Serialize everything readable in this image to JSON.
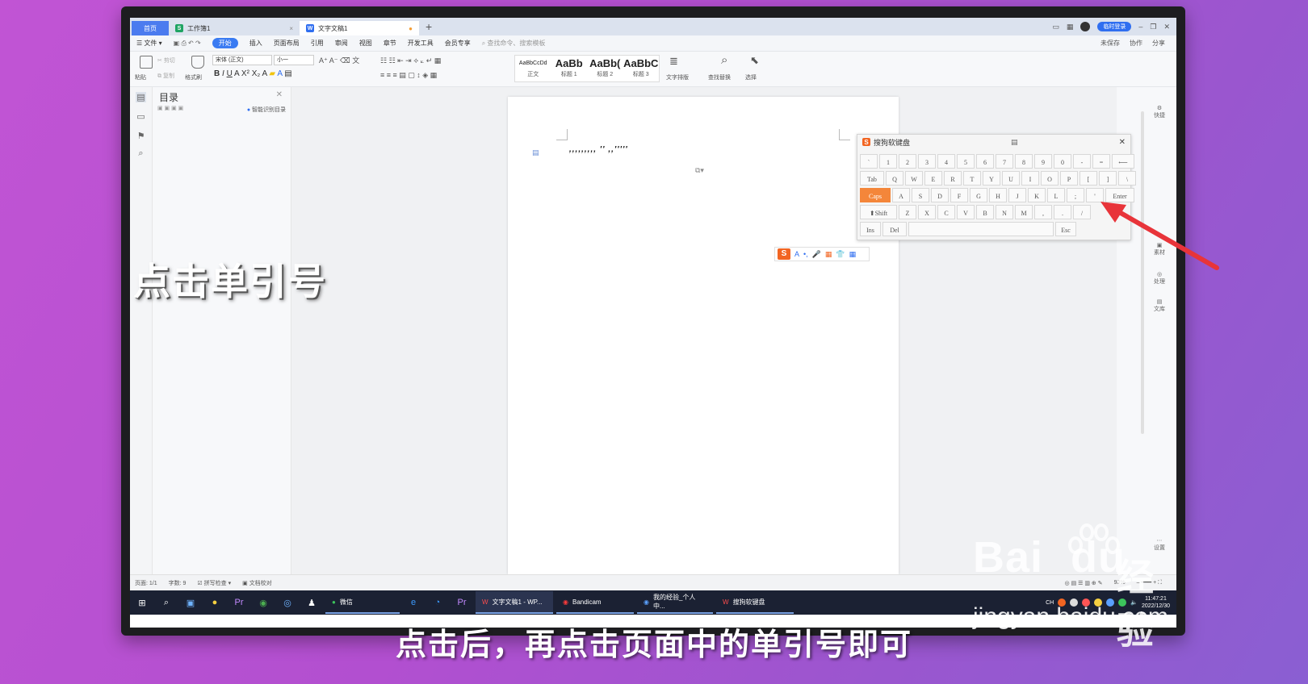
{
  "tabs": {
    "home": "首页",
    "sheet": "工作簿1",
    "doc": "文字文稿1",
    "login": "临时登录"
  },
  "menu": {
    "file": "文件",
    "items": [
      "开始",
      "插入",
      "页面布局",
      "引用",
      "审阅",
      "视图",
      "章节",
      "开发工具",
      "会员专享"
    ],
    "search": "查找命令、搜索模板",
    "right": [
      "未保存",
      "协作",
      "分享"
    ]
  },
  "ribbon": {
    "paste": "粘贴",
    "cut": "剪切",
    "copy": "复制",
    "format_painter": "格式刷",
    "font": "宋体 (正文)",
    "size": "小一",
    "styles": [
      {
        "sample": "AaBbCcDd",
        "name": "正文"
      },
      {
        "sample": "AaBb",
        "name": "标题 1"
      },
      {
        "sample": "AaBb(",
        "name": "标题 2"
      },
      {
        "sample": "AaBbC",
        "name": "标题 3"
      }
    ],
    "text_layout": "文字排版",
    "find_replace": "查找替换",
    "select": "选择"
  },
  "toc": {
    "title": "目录",
    "smart": "智能识别目录"
  },
  "document": {
    "text": ",,,,,,,,, '' ,,'''''"
  },
  "right_panel": [
    "快捷",
    "素材",
    "处理",
    "文库",
    "设置"
  ],
  "status": {
    "page": "页面: 1/1",
    "words": "字数: 9",
    "spell": "拼写检查",
    "proof": "文档校对",
    "zoom": "93%"
  },
  "taskbar": {
    "apps": [
      "微信",
      "文字文稿1 - WP...",
      "Bandicam",
      "我的经验_个人中...",
      "搜狗软键盘"
    ],
    "time": "11:47:21",
    "date": "2022/12/30",
    "lang": "CH"
  },
  "keyboard": {
    "title": "搜狗软键盘",
    "row1": [
      "`",
      "1",
      "2",
      "3",
      "4",
      "5",
      "6",
      "7",
      "8",
      "9",
      "0",
      "-",
      "=",
      "⟵"
    ],
    "row2": [
      "Tab",
      "Q",
      "W",
      "E",
      "R",
      "T",
      "Y",
      "U",
      "I",
      "O",
      "P",
      "[",
      "]",
      "\\"
    ],
    "row3": [
      "Caps",
      "A",
      "S",
      "D",
      "F",
      "G",
      "H",
      "J",
      "K",
      "L",
      ";",
      "'",
      "Enter"
    ],
    "row4": [
      "⬆Shift",
      "Z",
      "X",
      "C",
      "V",
      "B",
      "N",
      "M",
      ",",
      ".",
      "/"
    ],
    "row5": [
      "Ins",
      "Del",
      "",
      "Esc"
    ]
  },
  "overlay_text": "点击单引号",
  "caption": "点击后，再点击页面中的单引号即可",
  "watermark": {
    "logo": "Bai",
    "logo2": "du",
    "cn": "经验",
    "url": "jingyan.baidu.com"
  },
  "colors": {
    "accent": "#3a7bf2",
    "caps": "#f4863a",
    "arrow": "#e8343a"
  }
}
